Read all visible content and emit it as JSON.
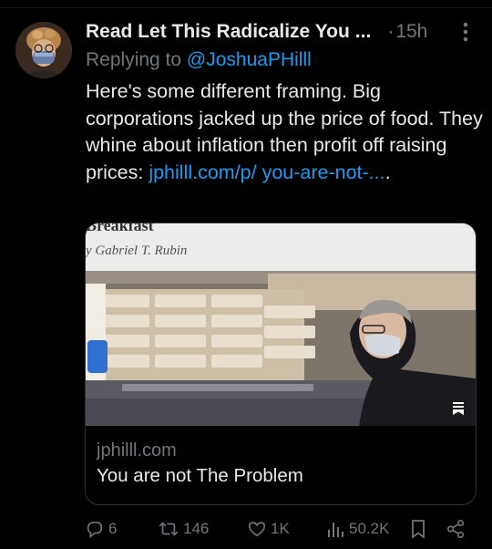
{
  "tweet": {
    "display_name": "Read Let This Radicalize You",
    "name_ellipsis": "...",
    "dot": "·",
    "time": "15h",
    "replying_prefix": "Replying to ",
    "replying_handle": "@JoshuaPHilll",
    "text_plain": "Here's some different framing. Big corporations jacked up the price of food. They whine about inflation then profit off raising prices: ",
    "text_link": "jphilll.com/p/ you-are-not-...",
    "text_suffix": "."
  },
  "card": {
    "image_headline_cut": "Breakfast",
    "image_byline": "y Gabriel T. Rubin",
    "domain": "jphilll.com",
    "title": "You are not The Problem"
  },
  "actions": {
    "replies": "6",
    "reposts": "146",
    "likes": "1K",
    "views": "50.2K"
  },
  "icons": {
    "more": "more-vertical-icon",
    "reply": "reply-icon",
    "repost": "repost-icon",
    "like": "heart-icon",
    "views": "views-icon",
    "bookmark": "bookmark-icon",
    "share": "share-icon"
  },
  "colors": {
    "background": "#000000",
    "text": "#e7e9ea",
    "secondary": "#71767b",
    "link": "#1d9bf0",
    "border": "#2f3336"
  }
}
